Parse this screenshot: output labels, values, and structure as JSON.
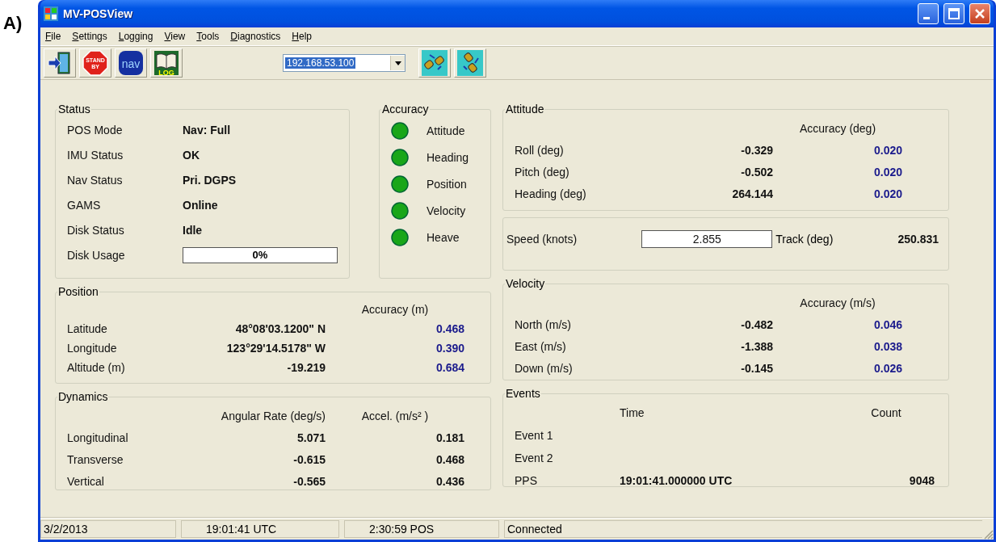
{
  "figure_label": "A)",
  "window": {
    "title": "MV-POSView"
  },
  "menu": [
    "File",
    "Settings",
    "Logging",
    "View",
    "Tools",
    "Diagnostics",
    "Help"
  ],
  "toolbar": {
    "buttons": [
      {
        "kind": "exit"
      },
      {
        "kind": "standby",
        "text": "STAND BY"
      },
      {
        "kind": "nav",
        "text": "nav"
      },
      {
        "kind": "log",
        "text": "LOG"
      }
    ],
    "address": {
      "value": "192.168.53.100",
      "text_selected": true
    },
    "connect_buttons": [
      {
        "kind": "connect"
      },
      {
        "kind": "disconnect"
      }
    ]
  },
  "status": {
    "title": "Status",
    "rows": [
      {
        "label": "POS Mode",
        "value": "Nav: Full"
      },
      {
        "label": "IMU Status",
        "value": "OK"
      },
      {
        "label": "Nav Status",
        "value": "Pri. DGPS"
      },
      {
        "label": "GAMS",
        "value": "Online"
      },
      {
        "label": "Disk Status",
        "value": "Idle"
      }
    ],
    "disk_usage": {
      "label": "Disk Usage",
      "level": 0,
      "reading": "0%"
    }
  },
  "accuracy": {
    "title": "Accuracy",
    "items": [
      {
        "label": "Attitude",
        "color": "#19a619"
      },
      {
        "label": "Heading",
        "color": "#19a619"
      },
      {
        "label": "Position",
        "color": "#19a619"
      },
      {
        "label": "Velocity",
        "color": "#19a619"
      },
      {
        "label": "Heave",
        "color": "#19a619"
      }
    ]
  },
  "position": {
    "title": "Position",
    "accuracy_header": "Accuracy (m)",
    "rows": [
      {
        "label": "Latitude",
        "value": "48°08'03.1200\" N",
        "accuracy": "0.468"
      },
      {
        "label": "Longitude",
        "value": "123°29'14.5178\" W",
        "accuracy": "0.390"
      },
      {
        "label": "Altitude (m)",
        "value": "-19.219",
        "accuracy": "0.684"
      }
    ]
  },
  "dynamics": {
    "title": "Dynamics",
    "rate_header": "Angular Rate (deg/s)",
    "accel_header": "Accel. (m/s² )",
    "rows": [
      {
        "label": "Longitudinal",
        "rate": "5.071",
        "accel": "0.181"
      },
      {
        "label": "Transverse",
        "rate": "-0.615",
        "accel": "0.468"
      },
      {
        "label": "Vertical",
        "rate": "-0.565",
        "accel": "0.436"
      }
    ]
  },
  "attitude": {
    "title": "Attitude",
    "accuracy_header": "Accuracy (deg)",
    "rows": [
      {
        "label": "Roll (deg)",
        "value": "-0.329",
        "accuracy": "0.020"
      },
      {
        "label": "Pitch (deg)",
        "value": "-0.502",
        "accuracy": "0.020"
      },
      {
        "label": "Heading (deg)",
        "value": "264.144",
        "accuracy": "0.020"
      }
    ]
  },
  "speed": {
    "label": "Speed (knots)",
    "value": "2.855",
    "track_label": "Track (deg)",
    "track_value": "250.831"
  },
  "velocity": {
    "title": "Velocity",
    "accuracy_header": "Accuracy (m/s)",
    "rows": [
      {
        "label": "North (m/s)",
        "value": "-0.482",
        "accuracy": "0.046"
      },
      {
        "label": "East  (m/s)",
        "value": "-1.388",
        "accuracy": "0.038"
      },
      {
        "label": "Down (m/s)",
        "value": "-0.145",
        "accuracy": "0.026"
      }
    ]
  },
  "events": {
    "title": "Events",
    "time_header": "Time",
    "count_header": "Count",
    "rows": [
      {
        "label": "Event 1"
      },
      {
        "label": "Event 2"
      },
      {
        "label": "PPS",
        "time": "19:01:41.000000 UTC",
        "count": "9048"
      }
    ]
  },
  "status_bar": [
    "3/2/2013",
    "19:01:41 UTC",
    "2:30:59 POS",
    "Connected"
  ]
}
